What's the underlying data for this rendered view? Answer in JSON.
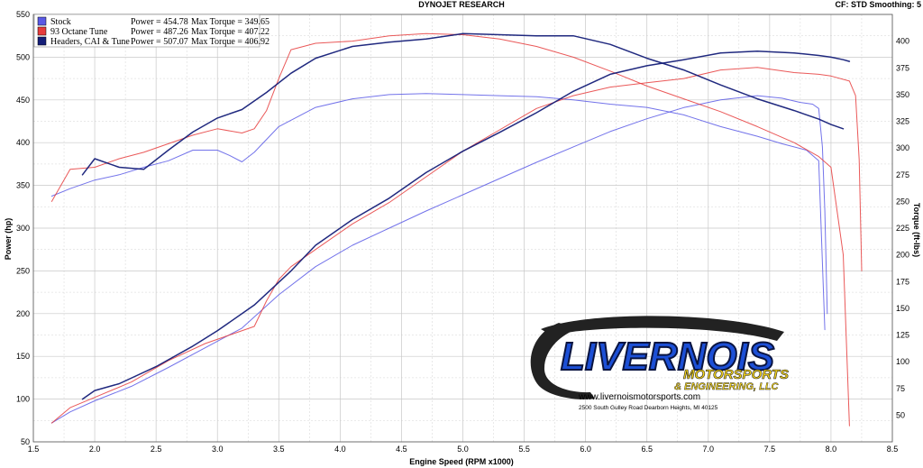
{
  "header": {
    "title": "DYNOJET RESEARCH",
    "settings": "CF: STD  Smoothing: 5"
  },
  "logo": {
    "line1": "LIVERNOIS",
    "line2": "MOTORSPORTS",
    "line3": "& ENGINEERING, LLC",
    "url": "www.livernoismotorsports.com",
    "address": "2500 South Gulley Road Dearborn Heights, MI 40125"
  },
  "colors": {
    "stock": "#5a5ae6",
    "tune93": "#e63c3c",
    "headers": "#141e78",
    "grid": "#c8c8c8",
    "logo_blue": "#1c4fd6",
    "logo_yellow": "#f2d21a"
  },
  "legend": {
    "rows": [
      {
        "name": "Stock",
        "power": "Power = 454.78",
        "torque": "Max Torque = 349.65",
        "color": "#5a5ae6"
      },
      {
        "name": "93 Octane Tune",
        "power": "Power = 487.26",
        "torque": "Max Torque = 407.22",
        "color": "#e63c3c"
      },
      {
        "name": "Headers, CAI & Tune",
        "power": "Power = 507.07",
        "torque": "Max Torque = 406.92",
        "color": "#141e78"
      }
    ]
  },
  "chart_data": {
    "type": "line",
    "xlabel": "Engine Speed (RPM x1000)",
    "ylabel": "Power (hp)",
    "y2label": "Torque (ft-lbs)",
    "xlim": [
      1.5,
      8.5
    ],
    "ylim": [
      50,
      550
    ],
    "y2lim": [
      25,
      425
    ],
    "grid": true,
    "xticks": [
      "1.5",
      "2.0",
      "2.5",
      "3.0",
      "3.5",
      "4.0",
      "4.5",
      "5.0",
      "5.5",
      "6.0",
      "6.5",
      "7.0",
      "7.5",
      "8.0",
      "8.5"
    ],
    "yticks": [
      "50",
      "100",
      "150",
      "200",
      "250",
      "300",
      "350",
      "400",
      "450",
      "500",
      "550"
    ],
    "y2ticks": [
      "50",
      "75",
      "100",
      "125",
      "150",
      "175",
      "200",
      "225",
      "250",
      "275",
      "300",
      "325",
      "350",
      "375",
      "400"
    ],
    "series": [
      {
        "name": "Stock",
        "color": "#5a5ae6",
        "power": {
          "x": [
            1.65,
            1.8,
            2.0,
            2.3,
            2.6,
            2.9,
            3.2,
            3.5,
            3.8,
            4.1,
            4.4,
            4.7,
            5.0,
            5.3,
            5.6,
            5.9,
            6.2,
            6.5,
            6.8,
            7.1,
            7.4,
            7.6,
            7.75,
            7.85,
            7.9,
            7.93,
            7.95,
            7.97
          ],
          "y": [
            72,
            85,
            98,
            115,
            137,
            160,
            183,
            222,
            255,
            280,
            300,
            320,
            339,
            358,
            377,
            395,
            413,
            428,
            441,
            450,
            455,
            452,
            447,
            445,
            440,
            395,
            320,
            200
          ]
        },
        "torque": {
          "x": [
            1.65,
            1.8,
            2.0,
            2.2,
            2.4,
            2.6,
            2.8,
            3.0,
            3.1,
            3.2,
            3.3,
            3.5,
            3.8,
            4.1,
            4.4,
            4.7,
            5.0,
            5.3,
            5.6,
            5.9,
            6.2,
            6.5,
            6.8,
            7.1,
            7.4,
            7.6,
            7.8,
            7.9,
            7.95
          ],
          "y": [
            255,
            262,
            270,
            275,
            282,
            288,
            298,
            298,
            293,
            287,
            296,
            320,
            338,
            346,
            350,
            351,
            350,
            349,
            348,
            345,
            341,
            338,
            331,
            320,
            311,
            304,
            298,
            288,
            130
          ]
        }
      },
      {
        "name": "93 Octane Tune",
        "color": "#e63c3c",
        "power": {
          "x": [
            1.65,
            1.8,
            2.0,
            2.3,
            2.6,
            2.9,
            3.1,
            3.3,
            3.4,
            3.5,
            3.6,
            3.8,
            4.1,
            4.4,
            4.7,
            5.0,
            5.3,
            5.6,
            5.9,
            6.2,
            6.5,
            6.8,
            7.1,
            7.4,
            7.7,
            7.9,
            8.0,
            8.15,
            8.2,
            8.23,
            8.25
          ],
          "y": [
            72,
            90,
            102,
            120,
            145,
            165,
            175,
            185,
            215,
            240,
            255,
            275,
            305,
            330,
            360,
            390,
            415,
            440,
            455,
            465,
            470,
            475,
            485,
            488,
            482,
            480,
            478,
            472,
            455,
            380,
            250
          ]
        },
        "torque": {
          "x": [
            1.65,
            1.8,
            2.0,
            2.2,
            2.4,
            2.6,
            2.8,
            3.0,
            3.2,
            3.3,
            3.4,
            3.5,
            3.6,
            3.8,
            4.1,
            4.4,
            4.7,
            5.0,
            5.3,
            5.6,
            5.9,
            6.2,
            6.5,
            6.8,
            7.1,
            7.4,
            7.7,
            7.9,
            8.0,
            8.1,
            8.15
          ],
          "y": [
            250,
            280,
            282,
            290,
            296,
            304,
            312,
            318,
            314,
            318,
            335,
            365,
            392,
            398,
            400,
            405,
            407,
            406,
            402,
            395,
            385,
            372,
            358,
            346,
            334,
            320,
            305,
            292,
            282,
            200,
            40
          ]
        }
      },
      {
        "name": "Headers, CAI & Tune",
        "color": "#141e78",
        "power": {
          "x": [
            1.9,
            2.0,
            2.2,
            2.5,
            2.8,
            3.0,
            3.3,
            3.6,
            3.8,
            4.1,
            4.4,
            4.7,
            5.0,
            5.3,
            5.6,
            5.9,
            6.2,
            6.5,
            6.8,
            7.1,
            7.4,
            7.7,
            7.9,
            8.0,
            8.1,
            8.15
          ],
          "y": [
            100,
            110,
            118,
            138,
            162,
            180,
            210,
            250,
            280,
            310,
            335,
            365,
            390,
            412,
            435,
            460,
            480,
            490,
            497,
            505,
            507,
            505,
            502,
            500,
            497,
            495
          ]
        },
        "torque": {
          "x": [
            1.9,
            2.0,
            2.2,
            2.4,
            2.6,
            2.8,
            3.0,
            3.2,
            3.4,
            3.6,
            3.8,
            4.1,
            4.4,
            4.7,
            5.0,
            5.3,
            5.6,
            5.9,
            6.2,
            6.5,
            6.8,
            7.1,
            7.4,
            7.7,
            7.9,
            8.0,
            8.1
          ],
          "y": [
            275,
            290,
            282,
            280,
            298,
            315,
            328,
            336,
            352,
            370,
            384,
            395,
            399,
            402,
            407,
            406,
            405,
            405,
            397,
            384,
            373,
            359,
            346,
            335,
            327,
            322,
            318
          ]
        }
      }
    ]
  }
}
